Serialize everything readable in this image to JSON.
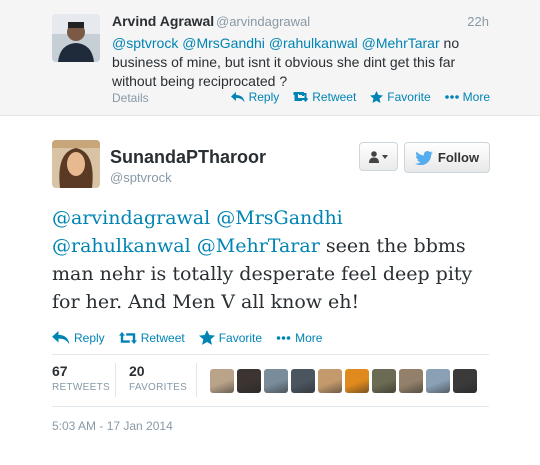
{
  "reply_tweet": {
    "name": "Arvind Agrawal",
    "handle": "@arvindagrawal",
    "time": "22h",
    "mentions": [
      "@sptvrock",
      "@MrsGandhi",
      "@rahulkanwal",
      "@MehrTarar"
    ],
    "text_line1_tail": "no",
    "text_line2": "business of mine, but isnt it obvious she dint get this far",
    "text_line3": "without being reciprocated ?",
    "details_label": "Details",
    "actions": {
      "reply": "Reply",
      "retweet": "Retweet",
      "favorite": "Favorite",
      "more": "More"
    }
  },
  "main_tweet": {
    "name": "SunandaPTharoor",
    "handle": "@sptvrock",
    "follow_label": "Follow",
    "mentions": [
      "@arvindagrawal",
      "@MrsGandhi",
      "@rahulkanwal",
      "@MehrTarar"
    ],
    "text_rest": "seen the bbms",
    "text_line3": "man nehr is totally desperate feel deep pity",
    "text_line4": "for her. And Men V all know eh!",
    "actions": {
      "reply": "Reply",
      "retweet": "Retweet",
      "favorite": "Favorite",
      "more": "More"
    },
    "stats": {
      "retweets": {
        "count": "67",
        "label": "RETWEETS"
      },
      "favorites": {
        "count": "20",
        "label": "FAVORITES"
      }
    },
    "timestamp": "5:03 AM - 17 Jan 2014"
  },
  "colors": {
    "link": "#0084b4",
    "muted": "#8899a6",
    "follow_bird": "#55acee"
  },
  "favoriter_avatar_colors": [
    "#b9a48a",
    "#3b3430",
    "#7a8c99",
    "#4a5560",
    "#c49a6c",
    "#e08a1e",
    "#6b6a52",
    "#93806a",
    "#8aa0b5",
    "#3a3a3a"
  ]
}
